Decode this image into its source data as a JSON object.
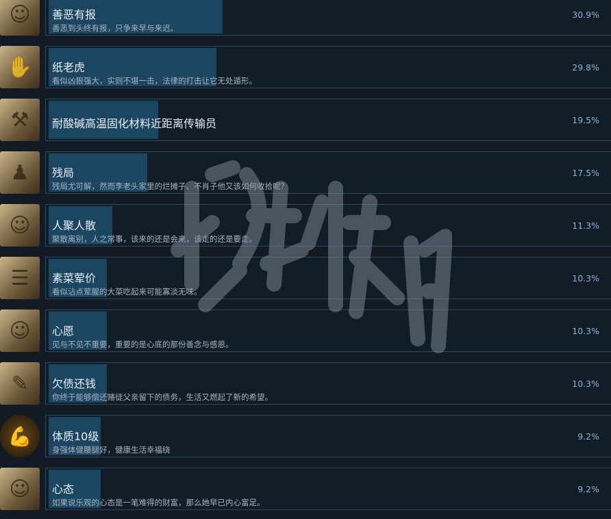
{
  "achievements": [
    {
      "title": "善恶有报",
      "desc": "善恶到头终有报，只争来早与来迟。",
      "pct": "30.9%",
      "fill": 30.9,
      "icon": "man-glasses-portrait-icon",
      "glyph": "☺",
      "round": false
    },
    {
      "title": "纸老虎",
      "desc": "看似凶狠强大，实则不堪一击，法律的打击让它无处遁形。",
      "pct": "29.8%",
      "fill": 29.8,
      "icon": "paper-tiger-icon",
      "glyph": "✋",
      "round": false
    },
    {
      "title": "耐酸碱高温固化材料近距离传输员",
      "desc": "",
      "pct": "19.5%",
      "fill": 19.5,
      "icon": "worker-icon",
      "glyph": "⚒",
      "round": false
    },
    {
      "title": "残局",
      "desc": "残局尤可解，然而李老头家里的烂摊子、不肖子他又该如何收拾呢？",
      "pct": "17.5%",
      "fill": 17.5,
      "icon": "chess-endgame-icon",
      "glyph": "♟",
      "round": false
    },
    {
      "title": "人聚人散",
      "desc": "聚散离别，人之常事，该来的还是会来，该走的还是要走。",
      "pct": "11.3%",
      "fill": 11.3,
      "icon": "young-man-portrait-icon",
      "glyph": "☺",
      "round": false
    },
    {
      "title": "素菜荤价",
      "desc": "看似沾点荤腥的大菜吃起来可能寡淡无味。",
      "pct": "10.3%",
      "fill": 10.3,
      "icon": "food-stall-icon",
      "glyph": "☰",
      "round": false
    },
    {
      "title": "心愿",
      "desc": "见与不见不重要，重要的是心底的那份善念与感恩。",
      "pct": "10.3%",
      "fill": 10.3,
      "icon": "elderly-woman-portrait-icon",
      "glyph": "☺",
      "round": false
    },
    {
      "title": "欠债还钱",
      "desc": "你终于能够偿还赌徒父亲留下的债务，生活又燃起了新的希望。",
      "pct": "10.3%",
      "fill": 10.3,
      "icon": "debt-notebook-icon",
      "glyph": "✎",
      "round": false
    },
    {
      "title": "体质10级",
      "desc": "身强体健腰腿好，健康生活幸福绕",
      "pct": "9.2%",
      "fill": 9.2,
      "icon": "flexed-arm-icon",
      "glyph": "💪",
      "round": true
    },
    {
      "title": "心态",
      "desc": "如果说乐观的心态是一笔难得的财富，那么她早已内心富足。",
      "pct": "9.2%",
      "fill": 9.2,
      "icon": "smiling-woman-portrait-icon",
      "glyph": "☺",
      "round": false
    }
  ],
  "colors": {
    "background": "#131a24",
    "bar": "#1b4560",
    "border": "#2a4a5e",
    "percent": "#7fb5d8"
  }
}
